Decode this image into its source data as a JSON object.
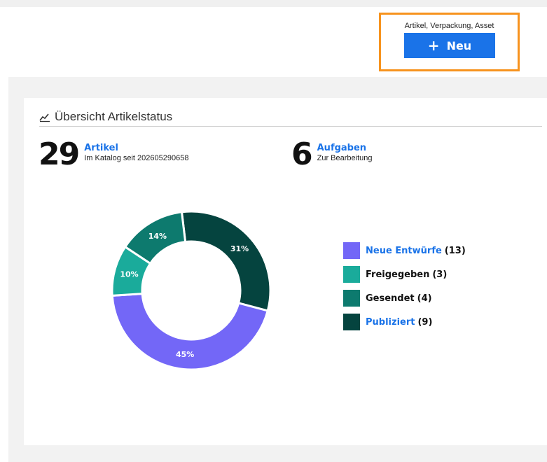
{
  "action_area": {
    "caption": "Artikel, Verpackung, Asset",
    "new_button_label": "Neu"
  },
  "card": {
    "title": "Übersicht Artikelstatus"
  },
  "stats": [
    {
      "number": "29",
      "label": "Artikel",
      "sub": "Im Katalog seit 202605290658"
    },
    {
      "number": "6",
      "label": "Aufgaben",
      "sub": "Zur Bearbeitung"
    }
  ],
  "legend": [
    {
      "label": "Neue Entwürfe",
      "count": "(13)",
      "link": true
    },
    {
      "label": "Freigegeben",
      "count": "(3)",
      "link": false
    },
    {
      "label": "Gesendet",
      "count": "(4)",
      "link": false
    },
    {
      "label": "Publiziert",
      "count": "(9)",
      "link": true
    }
  ],
  "colors": {
    "accent": "#1a73e8",
    "highlight_border": "#f7931e",
    "neue_entwuerfe": "#7367f7",
    "freigegeben": "#1aab9b",
    "gesendet": "#0d7a6e",
    "publiziert": "#05443f"
  },
  "chart_data": {
    "type": "pie",
    "categories": [
      "Neue Entwürfe",
      "Freigegeben",
      "Gesendet",
      "Publiziert"
    ],
    "values": [
      13,
      3,
      4,
      9
    ],
    "percent_labels": [
      "45%",
      "10%",
      "14%",
      "31%"
    ],
    "colors": [
      "#7367f7",
      "#1aab9b",
      "#0d7a6e",
      "#05443f"
    ],
    "donut": true,
    "legend": "right"
  }
}
